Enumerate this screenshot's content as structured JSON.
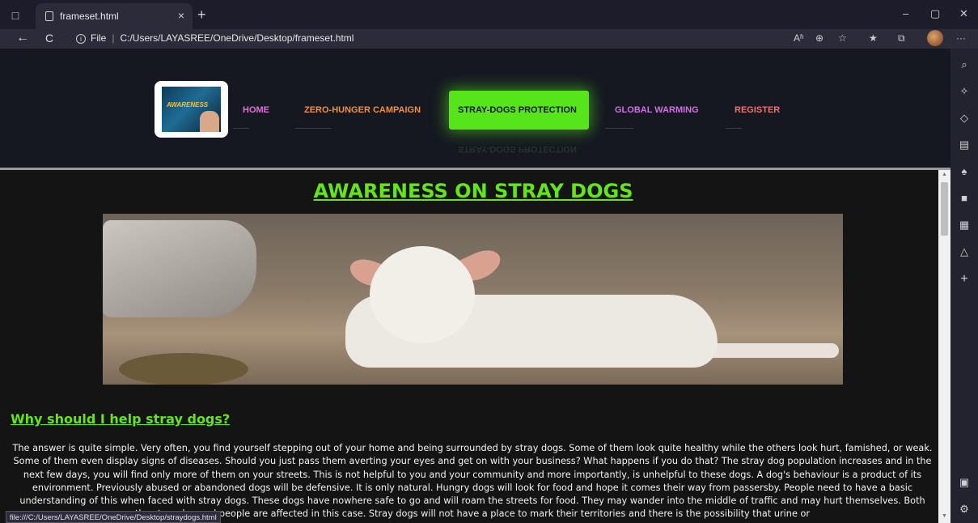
{
  "browser": {
    "tab_title": "frameset.html",
    "tab_close": "×",
    "new_tab": "+",
    "url_label": "File",
    "url_path": "C:/Users/LAYASREE/OneDrive/Desktop/frameset.html",
    "status_url": "file:///C:/Users/LAYASREE/OneDrive/Desktop/straydogs.html",
    "icons": {
      "back": "←",
      "reload": "C",
      "info": "i",
      "read_aloud": "Aʱ",
      "zoom": "⊕",
      "favorites_add": "☆",
      "favorites": "★",
      "collections": "⧉",
      "more": "···",
      "minimize": "–",
      "restore": "▢",
      "close": "✕",
      "sidebar_toggle": "□"
    }
  },
  "sidebar": {
    "icons": [
      "⌕",
      "✧",
      "◇",
      "▤",
      "♠",
      "■",
      "▦",
      "△",
      "+",
      "▣",
      "⚙"
    ]
  },
  "topnav": {
    "logo_text": "AWARENESS",
    "items": [
      {
        "label": "HOME",
        "color": "#e070d8"
      },
      {
        "label": "ZERO-HUNGER CAMPAIGN",
        "color": "#f0903a"
      },
      {
        "label": "STRAY-DOGS PROTECTION",
        "color": "#151821"
      },
      {
        "label": "GLOBAL WARMING",
        "color": "#d070e0"
      },
      {
        "label": "REGISTER",
        "color": "#f07070"
      }
    ],
    "active_index": 2,
    "active_color": "#55e51a"
  },
  "content": {
    "heading": "AWARENESS ON STRAY DOGS",
    "subheading": "Why should I help stray dogs?",
    "paragraph": "The answer is quite simple. Very often, you find yourself stepping out of your home and being surrounded by stray dogs. Some of them look quite healthy while the others look hurt, famished, or weak. Some of them even display signs of diseases. Should you just pass them averting your eyes and get on with your business? What happens if you do that? The stray dog population increases and in the next few days, you will find only more of them on your streets. This is not helpful to you and your community and more importantly, is unhelpful to these dogs. A dog's behaviour is a product of its environment. Previously abused or abandoned dogs will be defensive. It is only natural. Hungry dogs will look for food and hope it comes their way from passersby. People need to have a basic understanding of this when faced with stray dogs. These dogs have nowhere safe to go and will roam the streets for food. They may wander into the middle of traffic and may hurt themselves. Both the stray dog and people are affected in this case. Stray dogs will not have a place to mark their territories and there is the possibility that urine or",
    "heading_color": "#62e617"
  }
}
